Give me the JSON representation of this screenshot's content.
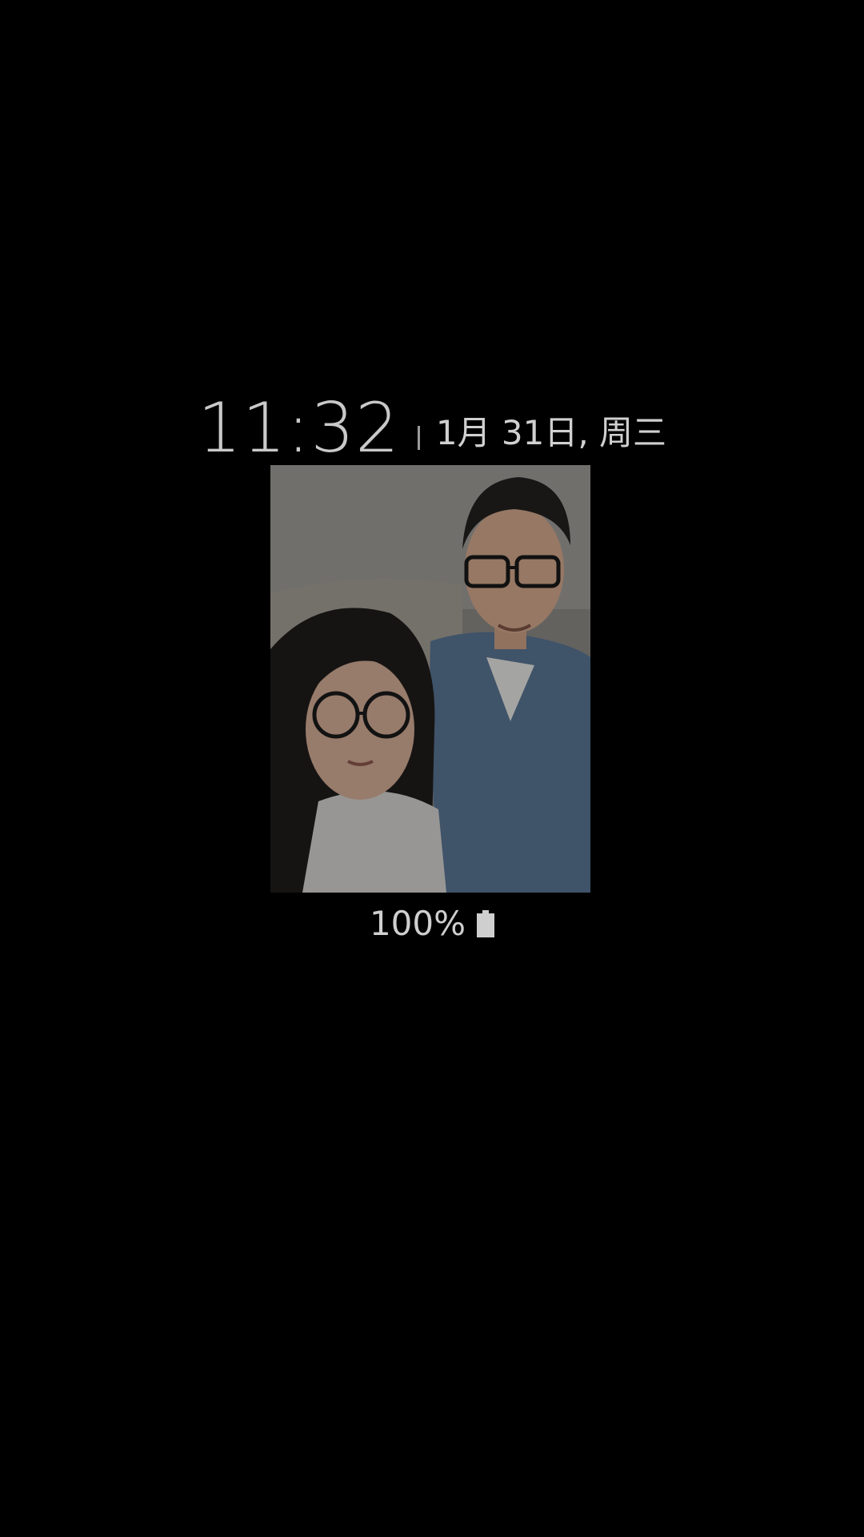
{
  "lockscreen": {
    "time": "11:32",
    "date": "1月 31日, 周三",
    "battery_text": "100%",
    "battery_level": 1.0
  },
  "photo": {
    "subject": "selfie-photo"
  },
  "icons": {
    "battery": "battery-full-icon"
  },
  "colors": {
    "background": "#000000",
    "text": "#cfcfcf"
  }
}
